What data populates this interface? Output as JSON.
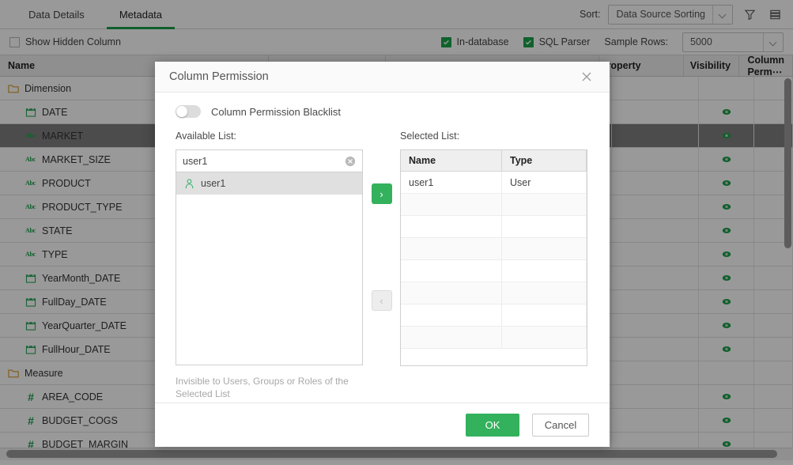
{
  "colors": {
    "accent": "#1aa34a",
    "button_green": "#33b15c",
    "tab_underline": "#1a9e4b",
    "selected_row": "#7f7f7f"
  },
  "topbar": {
    "tabs": [
      {
        "label": "Data Details",
        "active": false
      },
      {
        "label": "Metadata",
        "active": true
      }
    ],
    "sort_label": "Sort:",
    "sort_value": "Data Source Sorting",
    "filter_icon": "filter-icon",
    "list_icon": "list-view-icon"
  },
  "subbar": {
    "show_hidden_column": "Show Hidden Column",
    "in_database": "In-database",
    "sql_parser": "SQL Parser",
    "sample_rows_label": "Sample Rows:",
    "sample_rows_value": "5000"
  },
  "grid": {
    "columns": [
      "Name",
      "",
      "",
      "roperty",
      "Visibility",
      "Column Perm⋯"
    ],
    "rows": [
      {
        "name": "Dimension",
        "icon": "folder-icon",
        "level": 1,
        "selected": false,
        "visible": false
      },
      {
        "name": "DATE",
        "icon": "calendar-icon",
        "level": 2,
        "selected": false,
        "visible": true
      },
      {
        "name": "MARKET",
        "icon": "abc-icon",
        "level": 2,
        "selected": true,
        "visible": true
      },
      {
        "name": "MARKET_SIZE",
        "icon": "abc-icon",
        "level": 2,
        "selected": false,
        "visible": true
      },
      {
        "name": "PRODUCT",
        "icon": "abc-icon",
        "level": 2,
        "selected": false,
        "visible": true
      },
      {
        "name": "PRODUCT_TYPE",
        "icon": "abc-icon",
        "level": 2,
        "selected": false,
        "visible": true
      },
      {
        "name": "STATE",
        "icon": "abc-icon",
        "level": 2,
        "selected": false,
        "visible": true
      },
      {
        "name": "TYPE",
        "icon": "abc-icon",
        "level": 2,
        "selected": false,
        "visible": true
      },
      {
        "name": "YearMonth_DATE",
        "icon": "calendar-icon",
        "level": 2,
        "selected": false,
        "visible": true
      },
      {
        "name": "FullDay_DATE",
        "icon": "calendar-icon",
        "level": 2,
        "selected": false,
        "visible": true
      },
      {
        "name": "YearQuarter_DATE",
        "icon": "calendar-icon",
        "level": 2,
        "selected": false,
        "visible": true
      },
      {
        "name": "FullHour_DATE",
        "icon": "calendar-icon",
        "level": 2,
        "selected": false,
        "visible": true
      },
      {
        "name": "Measure",
        "icon": "folder-icon",
        "level": 1,
        "selected": false,
        "visible": false
      },
      {
        "name": "AREA_CODE",
        "icon": "hash-icon",
        "level": 2,
        "selected": false,
        "visible": true
      },
      {
        "name": "BUDGET_COGS",
        "icon": "hash-icon",
        "level": 2,
        "selected": false,
        "visible": true
      },
      {
        "name": "BUDGET_MARGIN",
        "icon": "hash-icon",
        "level": 2,
        "selected": false,
        "visible": true
      }
    ]
  },
  "modal": {
    "title": "Column Permission",
    "close_icon": "close-icon",
    "toggle_label": "Column Permission Blacklist",
    "toggle_on": false,
    "available_label": "Available List:",
    "selected_label": "Selected List:",
    "search_value": "user1",
    "search_placeholder": "",
    "available_items": [
      {
        "label": "user1",
        "icon": "user-icon",
        "highlighted": true
      }
    ],
    "move_right_label": "›",
    "move_left_label": "‹",
    "selected_table": {
      "headers": [
        "Name",
        "Type"
      ],
      "rows": [
        [
          "user1",
          "User"
        ]
      ],
      "empty_rows": 7
    },
    "hint": "Invisible to Users, Groups or Roles of the Selected List",
    "ok_label": "OK",
    "cancel_label": "Cancel"
  }
}
